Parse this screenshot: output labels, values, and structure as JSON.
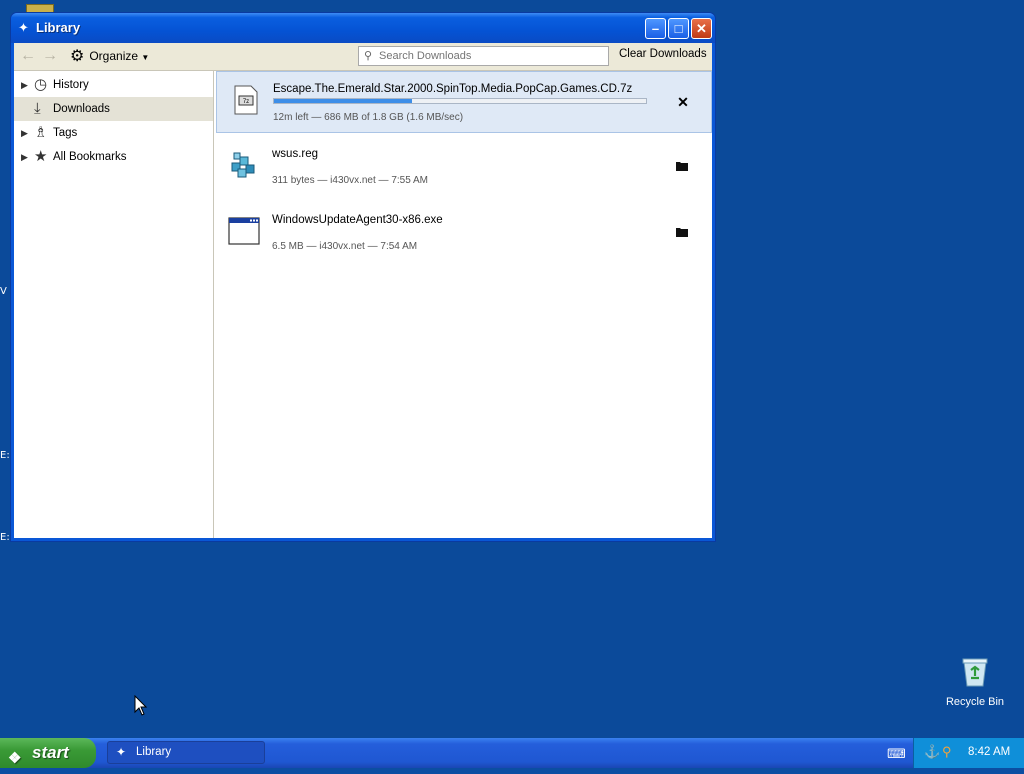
{
  "window": {
    "title": "Library",
    "buttons": [
      "minimize",
      "maximize",
      "close"
    ]
  },
  "toolbar": {
    "organize_label": "Organize",
    "search_placeholder": "Search Downloads",
    "clear_label": "Clear Downloads"
  },
  "sidebar": {
    "items": [
      {
        "label": "History",
        "icon": "clock-icon",
        "expandable": true
      },
      {
        "label": "Downloads",
        "icon": "download-arrow-icon",
        "expandable": false,
        "selected": true
      },
      {
        "label": "Tags",
        "icon": "tag-icon",
        "expandable": true
      },
      {
        "label": "All Bookmarks",
        "icon": "star-icon",
        "expandable": true
      }
    ]
  },
  "downloads": [
    {
      "name": "Escape.The.Emerald.Star.2000.SpinTop.Media.PopCap.Games.CD.7z",
      "meta": "12m left — 686 MB of 1.8 GB (1.6 MB/sec)",
      "progress": 0.37,
      "action_icon": "cancel-x-icon",
      "in_progress": true
    },
    {
      "name": "wsus.reg",
      "meta": "311 bytes — i430vx.net — 7:55 AM",
      "action_icon": "open-folder-icon",
      "in_progress": false
    },
    {
      "name": "WindowsUpdateAgent30-x86.exe",
      "meta": "6.5 MB — i430vx.net — 7:54 AM",
      "action_icon": "open-folder-icon",
      "in_progress": false
    }
  ],
  "taskbar": {
    "start_label": "start",
    "task_label": "Library",
    "clock": "8:42 AM"
  },
  "desktop": {
    "recycle_bin_label": "Recycle Bin",
    "left_fragments": [
      "V",
      "E:",
      "E:"
    ]
  },
  "colors": {
    "desktop": "#0b4a9a",
    "titlebar": "#0553d4",
    "progress_fill": "#3d8ee8",
    "active_row": "#dfe9f6",
    "tray": "#0f8fd9"
  }
}
